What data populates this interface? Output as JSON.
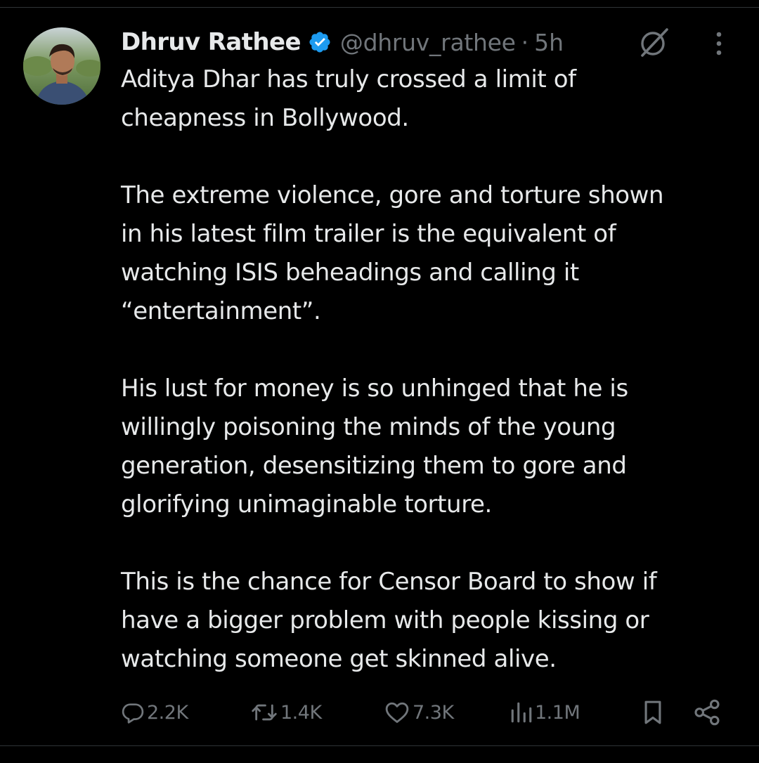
{
  "tweet": {
    "author": {
      "display_name": "Dhruv Rathee",
      "handle": "@dhruv_rathee",
      "verified_icon": "verified-badge-icon",
      "verified_color": "#1d9bf0"
    },
    "separator": "·",
    "time": "5h",
    "paragraphs": [
      [
        "Aditya Dhar has truly crossed a limit of",
        "cheapness in Bollywood."
      ],
      [
        "The extreme violence, gore and torture  shown",
        "in his latest film trailer is the equivalent of",
        "watching ISIS beheadings and calling it",
        "“entertainment”."
      ],
      [
        "His lust for money is so unhinged that he is",
        "willingly poisoning the minds of the young",
        "generation, desensitizing them to gore and",
        "glorifying unimaginable torture."
      ],
      [
        "This is the chance for Censor Board to show if",
        "have a bigger problem with people kissing or",
        "watching someone get skinned alive."
      ]
    ],
    "actions": {
      "replies": "2.2K",
      "reposts": "1.4K",
      "likes": "7.3K",
      "views": "1.1M"
    }
  },
  "icons": {
    "grok": "grok-icon",
    "more": "more-vertical-icon",
    "reply": "reply-icon",
    "repost": "repost-icon",
    "like": "heart-icon",
    "views": "views-icon",
    "bookmark": "bookmark-icon",
    "share": "share-icon"
  },
  "colors": {
    "background": "#000000",
    "text": "#e7e9ea",
    "secondary": "#71767b",
    "divider": "#2f3336"
  }
}
